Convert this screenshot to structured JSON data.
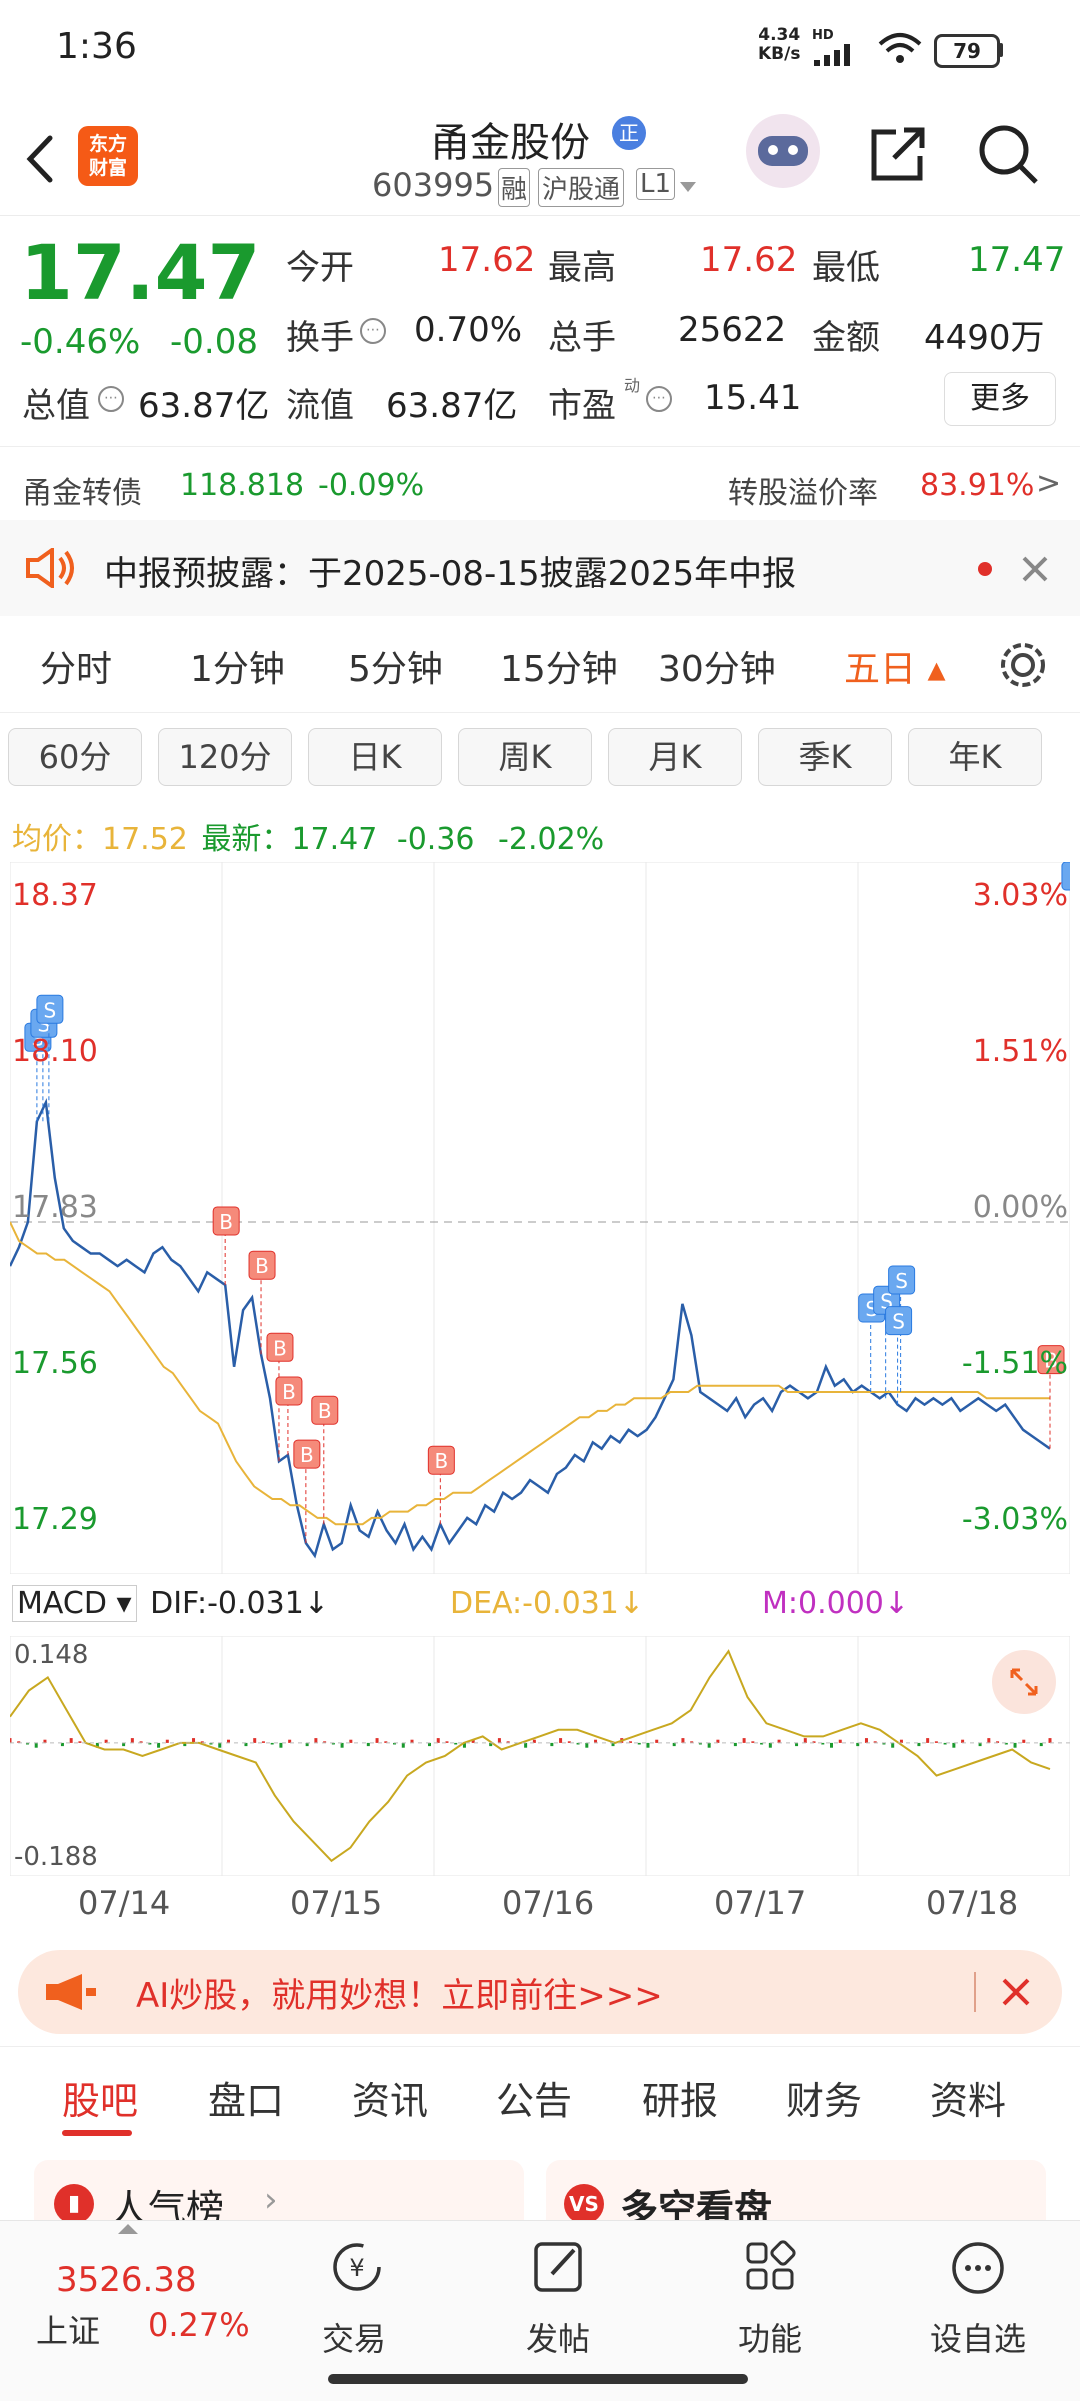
{
  "status_bar": {
    "time": "1:36",
    "net_speed_top": "4.34",
    "net_speed_bottom": "KB/s",
    "hd": "HD",
    "battery": "79"
  },
  "header": {
    "back_icon": "chevron-left-icon",
    "app_logo_top": "东方",
    "app_logo_bottom": "财富",
    "stock_name": "甬金股份",
    "badge": "正",
    "stock_code": "603995",
    "tag_margin": "融",
    "tag_connect": "沪股通",
    "tag_level": "L1"
  },
  "quote": {
    "price": "17.47",
    "change_pct": "-0.46%",
    "change_amt": "-0.08",
    "open_label": "今开",
    "open": "17.62",
    "high_label": "最高",
    "high": "17.62",
    "low_label": "最低",
    "low": "17.47",
    "turnover_label": "换手",
    "turnover": "0.70%",
    "volume_label": "总手",
    "volume": "25622",
    "amount_label": "金额",
    "amount": "4490万",
    "mktcap_label": "总值",
    "mktcap": "63.87亿",
    "float_label": "流值",
    "float": "63.87亿",
    "pe_label": "市盈",
    "pe_sup": "动",
    "pe": "15.41",
    "more": "更多"
  },
  "bond": {
    "name": "甬金转债",
    "price": "118.818",
    "change": "-0.09%",
    "premium_label": "转股溢价率",
    "premium": "83.91%",
    "arrow": ">"
  },
  "notice": {
    "text": "中报预披露：于2025-08-15披露2025年中报"
  },
  "period_tabs": [
    "分时",
    "1分钟",
    "5分钟",
    "15分钟",
    "30分钟",
    "五日"
  ],
  "active_period": "五日",
  "k_tabs": [
    "60分",
    "120分",
    "日K",
    "周K",
    "月K",
    "季K",
    "年K"
  ],
  "chart_info": {
    "avg_label": "均价：",
    "avg": "17.52",
    "latest_label": "最新：",
    "latest": "17.47",
    "chg": "-0.36",
    "chg_pct": "-2.02%"
  },
  "macd_info": {
    "name": "MACD",
    "dif": "DIF:-0.031",
    "dea": "DEA:-0.031",
    "m": "M:0.000"
  },
  "banner": {
    "text": "AI炒股，就用妙想！立即前往>>>"
  },
  "bottom_tabs": [
    "股吧",
    "盘口",
    "资讯",
    "公告",
    "研报",
    "财务",
    "资料"
  ],
  "active_bottom_tab": "股吧",
  "cards": {
    "left": "人气榜",
    "right": "多空看盘"
  },
  "bottom_nav": {
    "index_value": "3526.38",
    "index_name": "上证",
    "index_change": "0.27%",
    "trade": "交易",
    "post": "发帖",
    "func": "功能",
    "watch": "设自选"
  },
  "colors": {
    "up": "#e0302a",
    "down": "#1a9a2e",
    "price_line": "#2a5ea8",
    "avg_line": "#e8b43a",
    "accent": "#f0601e"
  },
  "chart_data": {
    "type": "line",
    "x_categories": [
      "07/14",
      "07/15",
      "07/16",
      "07/17",
      "07/18"
    ],
    "price_axis": [
      "18.37",
      "18.10",
      "17.83",
      "17.56",
      "17.29"
    ],
    "pct_axis": [
      "3.03%",
      "1.51%",
      "0.00%",
      "-1.51%",
      "-3.03%"
    ],
    "ylim": [
      17.29,
      18.37
    ],
    "prev_close": 17.83,
    "series": [
      {
        "values": [
          17.76,
          17.79,
          17.83,
          17.99,
          18.02,
          17.9,
          17.82,
          17.8,
          17.79,
          17.78,
          17.78,
          17.77,
          17.76,
          17.77,
          17.76,
          17.75,
          17.78,
          17.79,
          17.77,
          17.76,
          17.74,
          17.72,
          17.75,
          17.74,
          17.73,
          17.6,
          17.69,
          17.71,
          17.62,
          17.55,
          17.45,
          17.46,
          17.38,
          17.32,
          17.3,
          17.35,
          17.31,
          17.32,
          17.38,
          17.34,
          17.33,
          17.37,
          17.34,
          17.32,
          17.35,
          17.31,
          17.33,
          17.31,
          17.35,
          17.32,
          17.34,
          17.36,
          17.35,
          17.38,
          17.37,
          17.4,
          17.39,
          17.4,
          17.42,
          17.41,
          17.4,
          17.43,
          17.44,
          17.46,
          17.45,
          17.48,
          17.47,
          17.49,
          17.48,
          17.5,
          17.49,
          17.5,
          17.52,
          17.55,
          17.58,
          17.7,
          17.65,
          17.56,
          17.55,
          17.54,
          17.53,
          17.55,
          17.52,
          17.54,
          17.55,
          17.53,
          17.56,
          17.57,
          17.56,
          17.55,
          17.56,
          17.6,
          17.57,
          17.58,
          17.56,
          17.57,
          17.56,
          17.55,
          17.56,
          17.54,
          17.53,
          17.55,
          17.54,
          17.55,
          17.54,
          17.55,
          17.53,
          17.54,
          17.55,
          17.54,
          17.53,
          17.54,
          17.52,
          17.5,
          17.49,
          17.48,
          17.47
        ]
      },
      {
        "values": [
          17.83,
          17.8,
          17.79,
          17.78,
          17.78,
          17.77,
          17.77,
          17.76,
          17.75,
          17.74,
          17.73,
          17.72,
          17.7,
          17.68,
          17.66,
          17.64,
          17.62,
          17.6,
          17.59,
          17.57,
          17.55,
          17.53,
          17.52,
          17.51,
          17.48,
          17.45,
          17.43,
          17.41,
          17.4,
          17.39,
          17.39,
          17.38,
          17.38,
          17.37,
          17.36,
          17.36,
          17.35,
          17.35,
          17.35,
          17.35,
          17.36,
          17.36,
          17.37,
          17.37,
          17.37,
          17.38,
          17.38,
          17.39,
          17.39,
          17.4,
          17.4,
          17.4,
          17.41,
          17.42,
          17.43,
          17.44,
          17.45,
          17.46,
          17.47,
          17.48,
          17.49,
          17.5,
          17.51,
          17.52,
          17.52,
          17.53,
          17.53,
          17.54,
          17.54,
          17.55,
          17.55,
          17.55,
          17.55,
          17.56,
          17.56,
          17.56,
          17.57,
          17.57,
          17.57,
          17.57,
          17.57,
          17.57,
          17.57,
          17.57,
          17.57,
          17.57,
          17.56,
          17.56,
          17.56,
          17.56,
          17.56,
          17.56,
          17.56,
          17.56,
          17.56,
          17.56,
          17.56,
          17.56,
          17.56,
          17.56,
          17.56,
          17.56,
          17.56,
          17.56,
          17.56,
          17.56,
          17.56,
          17.56,
          17.55,
          17.55,
          17.55,
          17.55,
          17.55,
          17.55,
          17.55,
          17.55
        ]
      }
    ],
    "macd_axis": [
      "0.148",
      "-0.188"
    ],
    "macd_ylim": [
      -0.188,
      0.148
    ],
    "macd_series": [
      0.04,
      0.08,
      0.1,
      0.05,
      0.0,
      -0.01,
      -0.01,
      -0.02,
      -0.01,
      0.0,
      0.0,
      -0.01,
      -0.02,
      -0.03,
      -0.08,
      -0.12,
      -0.15,
      -0.18,
      -0.16,
      -0.12,
      -0.09,
      -0.05,
      -0.03,
      -0.02,
      0.0,
      0.01,
      -0.01,
      0.0,
      0.01,
      0.02,
      0.02,
      0.01,
      0.0,
      0.01,
      0.02,
      0.03,
      0.05,
      0.1,
      0.14,
      0.07,
      0.03,
      0.02,
      0.01,
      0.01,
      0.02,
      0.03,
      0.02,
      0.0,
      -0.02,
      -0.05,
      -0.04,
      -0.03,
      -0.02,
      -0.01,
      -0.03,
      -0.04
    ],
    "markers": {
      "buy": "B",
      "sell": "S"
    }
  }
}
